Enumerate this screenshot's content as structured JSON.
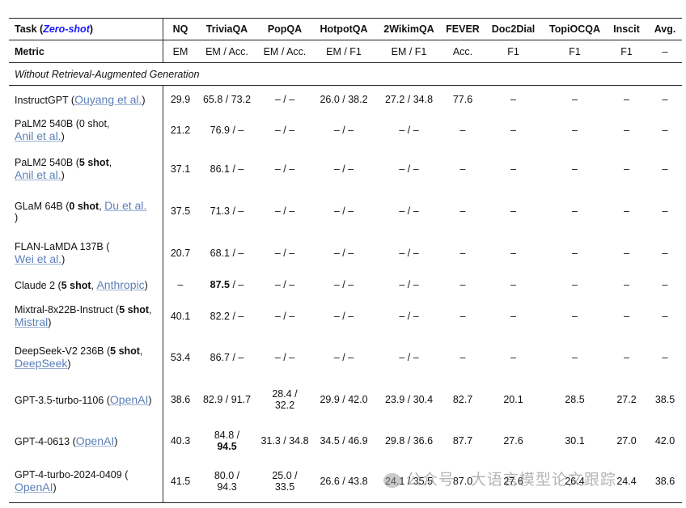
{
  "header": {
    "task_label": "Task",
    "task_mode": "Zero-shot",
    "columns": [
      "NQ",
      "TriviaQA",
      "PopQA",
      "HotpotQA",
      "2WikimQA",
      "FEVER",
      "Doc2Dial",
      "TopiOCQA",
      "Inscit",
      "Avg."
    ]
  },
  "metric": {
    "label": "Metric",
    "values": [
      "EM",
      "EM / Acc.",
      "EM / Acc.",
      "EM / F1",
      "EM / F1",
      "Acc.",
      "F1",
      "F1",
      "F1",
      "–"
    ]
  },
  "section_title": "Without Retrieval-Augmented Generation",
  "rows": [
    {
      "h": 34,
      "model": [
        {
          "t": "InstructGPT ("
        },
        {
          "t": "Ouyang et al.",
          "c": 1
        },
        {
          "t": ")"
        }
      ],
      "cells": [
        "29.9",
        "65.8 / 73.2",
        "– / –",
        "26.0 / 38.2",
        "27.2 / 34.8",
        "77.6",
        "–",
        "–",
        "–",
        "–"
      ]
    },
    {
      "h": 43,
      "model": [
        {
          "t": "PaLM2 540B (0 shot,"
        },
        {
          "br": 1
        },
        {
          "t": "Anil et al.",
          "c": 1
        },
        {
          "t": ")"
        }
      ],
      "cells": [
        "21.2",
        "76.9 / –",
        "– / –",
        "– / –",
        "– / –",
        "–",
        "–",
        "–",
        "–",
        "–"
      ]
    },
    {
      "h": 53,
      "model": [
        {
          "t": "PaLM2 540B ("
        },
        {
          "t": "5 shot",
          "b": 1
        },
        {
          "t": ","
        },
        {
          "br": 1
        },
        {
          "t": "Anil et al.",
          "c": 1
        },
        {
          "t": ")"
        }
      ],
      "cells": [
        "37.1",
        "86.1 / –",
        "– / –",
        "– / –",
        "– / –",
        "–",
        "–",
        "–",
        "–",
        "–"
      ]
    },
    {
      "h": 51,
      "model": [
        {
          "t": "GLaM 64B  ("
        },
        {
          "t": "0 shot",
          "b": 1
        },
        {
          "t": ", "
        },
        {
          "t": "Du et al.",
          "c": 1
        },
        {
          "br": 1
        },
        {
          "t": ")"
        }
      ],
      "cells": [
        "37.5",
        "71.3 / –",
        "– / –",
        "– / –",
        "– / –",
        "–",
        "–",
        "–",
        "–",
        "–"
      ]
    },
    {
      "h": 52,
      "model": [
        {
          "t": "FLAN-LaMDA 137B ("
        },
        {
          "br": 1
        },
        {
          "t": "Wei et al.",
          "c": 1
        },
        {
          "t": ")"
        }
      ],
      "cells": [
        "20.7",
        "68.1 / –",
        "– / –",
        "– / –",
        "– / –",
        "–",
        "–",
        "–",
        "–",
        "–"
      ]
    },
    {
      "h": 27,
      "model": [
        {
          "t": "Claude 2 ("
        },
        {
          "t": "5 shot",
          "b": 1
        },
        {
          "t": ", "
        },
        {
          "t": "Anthropic",
          "c": 1
        },
        {
          "t": ")"
        }
      ],
      "cells": [
        "–",
        "87.5 / –",
        "– / –",
        "– / –",
        "– / –",
        "–",
        "–",
        "–",
        "–",
        "–"
      ],
      "bold_cell": 1
    },
    {
      "h": 51,
      "model": [
        {
          "t": "Mixtral-8x22B-Instruct ("
        },
        {
          "t": "5 shot",
          "b": 1
        },
        {
          "t": ","
        },
        {
          "br": 1
        },
        {
          "t": "Mistral",
          "c": 1
        },
        {
          "t": ")"
        }
      ],
      "cells": [
        "40.1",
        "82.2 / –",
        "– / –",
        "– / –",
        "– / –",
        "–",
        "–",
        "–",
        "–",
        "–"
      ]
    },
    {
      "h": 51,
      "model": [
        {
          "t": "DeepSeek-V2 236B ("
        },
        {
          "t": "5 shot",
          "b": 1
        },
        {
          "t": ","
        },
        {
          "br": 1
        },
        {
          "t": "DeepSeek",
          "c": 1
        },
        {
          "t": ")"
        }
      ],
      "cells": [
        "53.4",
        "86.7 / –",
        "– / –",
        "– / –",
        "– / –",
        "–",
        "–",
        "–",
        "–",
        "–"
      ]
    },
    {
      "h": 52,
      "model": [
        {
          "t": "GPT-3.5-turbo-1106 ("
        },
        {
          "t": "OpenAI",
          "c": 1
        },
        {
          "t": ")"
        }
      ],
      "cells": [
        "38.6",
        "82.9 / 91.7",
        "28.4 /\n32.2",
        "29.9 / 42.0",
        "23.9 / 30.4",
        "82.7",
        "20.1",
        "28.5",
        "27.2",
        "38.5"
      ]
    },
    {
      "h": 50,
      "model": [
        {
          "t": "GPT-4-0613 ("
        },
        {
          "t": "OpenAI",
          "c": 1
        },
        {
          "t": ")"
        }
      ],
      "cells": [
        "40.3",
        "84.8 /\n94.5",
        "31.3 / 34.8",
        "34.5 / 46.9",
        "29.8 / 36.6",
        "87.7",
        "27.6",
        "30.1",
        "27.0",
        "42.0"
      ],
      "bold_second": 1
    },
    {
      "h": 52,
      "model": [
        {
          "t": "GPT-4-turbo-2024-0409 ("
        },
        {
          "br": 1
        },
        {
          "t": "OpenAI",
          "c": 1
        },
        {
          "t": ")"
        }
      ],
      "cells": [
        "41.5",
        "80.0 /\n94.3",
        "25.0 /\n33.5",
        "26.6 / 43.8",
        "24.1 / 35.5",
        "87.0",
        "27.6",
        "26.4",
        "24.4",
        "38.6"
      ]
    }
  ],
  "watermark": "公众号 · 大语言模型论文跟踪"
}
